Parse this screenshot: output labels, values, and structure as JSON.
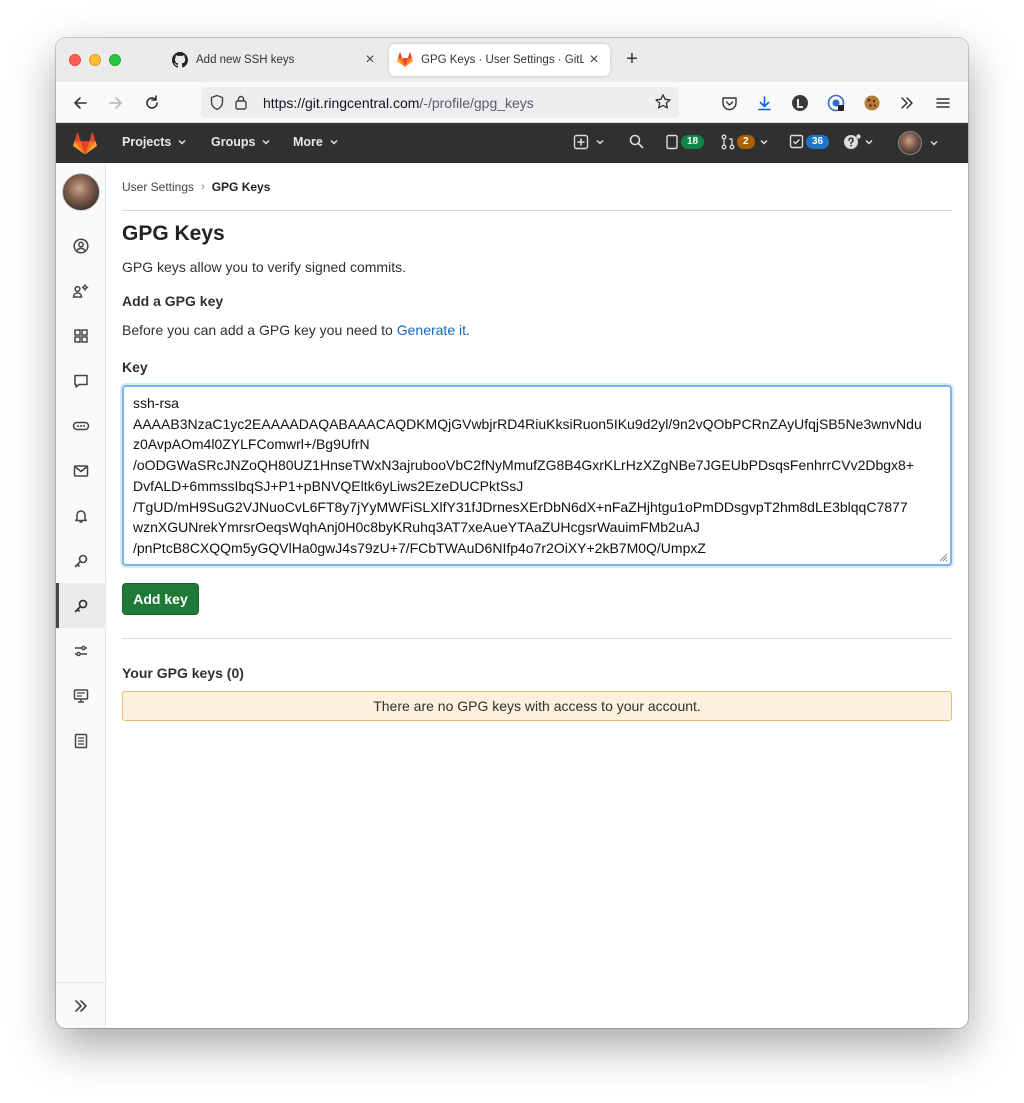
{
  "browser": {
    "tabs": [
      {
        "title": "Add new SSH keys",
        "icon": "github-icon",
        "close": "×"
      },
      {
        "title": "GPG Keys · User Settings · GitLab",
        "icon": "gitlab-icon",
        "close": "×"
      }
    ],
    "new_tab": "+",
    "url_host": "https://git.ringcentral.com",
    "url_path": "/-/profile/gpg_keys"
  },
  "header": {
    "nav": [
      {
        "label": "Projects"
      },
      {
        "label": "Groups"
      },
      {
        "label": "More"
      }
    ],
    "issues_count": "18",
    "merge_requests_count": "2",
    "todos_count": "36",
    "colors": {
      "issues": "#108548",
      "merge_requests": "#ab6100",
      "todos": "#1f75cb"
    }
  },
  "breadcrumb": {
    "parent": "User Settings",
    "separator": "›",
    "current": "GPG Keys"
  },
  "page": {
    "title": "GPG Keys",
    "description": "GPG keys allow you to verify signed commits.",
    "add_heading": "Add a GPG key",
    "help_prefix": "Before you can add a GPG key you need to ",
    "help_link": "Generate it",
    "help_suffix": ".",
    "key_label": "Key",
    "key_value": "ssh-rsa\nAAAAB3NzaC1yc2EAAAADAQABAAACAQDKMQjGVwbjrRD4RiuKksiRuon5IKu9d2yl/9n2vQObPCRnZAyUfqjSB5Ne3wnvNdu\nz0AvpAOm4l0ZYLFComwrl+/Bg9UfrN\n/oODGWaSRcJNZoQH80UZ1HnseTWxN3ajruboοVbC2fNyMmufZG8B4GxrKLrHzXZgNBe7JGEUbPDsqsFenhrrCVv2Dbgx8+\nDvfALD+6mmssIbqSJ+P1+pBNVQEltk6yLiws2EzeDUCPktSsJ\n/TgUD/mH9SuG2VJNuoCvL6FT8y7jYyMWFiSLXlfY31fJDrnesXErDbN6dX+nFaZHjhtgu1oPmDDsgvpT2hm8dLE3blqqC7877\nwznXGUNrekYmrsrOeqsWqhAnj0H0c8byKRuhq3AT7xeAueYTAaZUHcgsrWauimFMb2uAJ\n/pnPtcB8CXQQm5yGQVlHa0gwJ4s79zU+7/FCbTWAuD6NIfp4o7r2OiXY+2kB7M0Q/UmpxZ",
    "add_button": "Add key",
    "your_keys": "Your GPG keys (0)",
    "empty_message": "There are no GPG keys with access to your account."
  }
}
